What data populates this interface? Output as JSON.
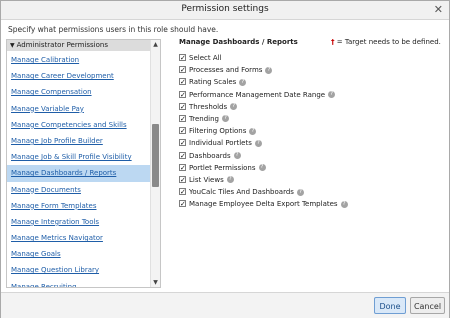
{
  "dialog": {
    "title": "Permission settings",
    "instruction_prefix": "Specify what permissions users in this role should have.",
    "instruction_link": "?"
  },
  "sidebar": {
    "category": "Administrator Permissions",
    "items": [
      {
        "label": "Manage Calibration"
      },
      {
        "label": "Manage Career Development"
      },
      {
        "label": "Manage Compensation"
      },
      {
        "label": "Manage Variable Pay"
      },
      {
        "label": "Manage Competencies and Skills"
      },
      {
        "label": "Manage Job Profile Builder"
      },
      {
        "label": "Manage Job & Skill Profile Visibility"
      },
      {
        "label": "Manage Dashboards / Reports",
        "selected": true
      },
      {
        "label": "Manage Documents"
      },
      {
        "label": "Manage Form Templates"
      },
      {
        "label": "Manage Integration Tools"
      },
      {
        "label": "Manage Metrics Navigator"
      },
      {
        "label": "Manage Goals"
      },
      {
        "label": "Manage Question Library"
      },
      {
        "label": "Manage Recruiting"
      }
    ]
  },
  "main": {
    "header": "Manage Dashboards / Reports",
    "legend_star": "†",
    "legend_text": "= Target needs to be defined.",
    "permissions": [
      {
        "label": "Select All",
        "checked": true,
        "help": false
      },
      {
        "label": "Processes and Forms",
        "checked": true,
        "help": true
      },
      {
        "label": "Rating Scales",
        "checked": true,
        "help": true
      },
      {
        "label": "Performance Management Date Range",
        "checked": true,
        "help": true
      },
      {
        "label": "Thresholds",
        "checked": true,
        "help": true
      },
      {
        "label": "Trending",
        "checked": true,
        "help": true
      },
      {
        "label": "Filtering Options",
        "checked": true,
        "help": true
      },
      {
        "label": "Individual Portlets",
        "checked": true,
        "help": true
      },
      {
        "label": "Dashboards",
        "checked": true,
        "help": true
      },
      {
        "label": "Portlet Permissions",
        "checked": true,
        "help": true
      },
      {
        "label": "List Views",
        "checked": true,
        "help": true
      },
      {
        "label": "YouCalc Tiles And Dashboards",
        "checked": true,
        "help": true
      },
      {
        "label": "Manage Employee Delta Export Templates",
        "checked": true,
        "help": true
      }
    ]
  },
  "footer": {
    "done_label": "Done",
    "cancel_label": "Cancel"
  }
}
